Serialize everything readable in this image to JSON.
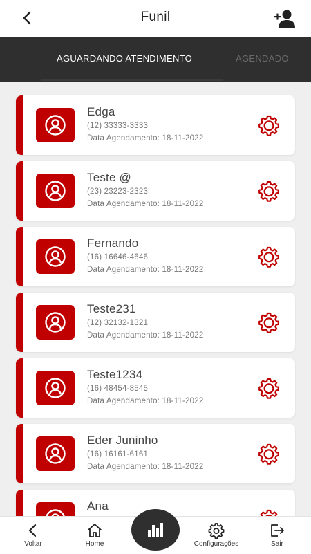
{
  "header": {
    "title": "Funil",
    "back_icon": "chevron-left-icon",
    "add_user_icon": "user-plus-icon"
  },
  "tabs": [
    {
      "label": "AGUARDANDO ATENDIMENTO",
      "active": true
    },
    {
      "label": "AGENDADO",
      "active": false
    }
  ],
  "contacts": [
    {
      "name": "Edga",
      "phone": "(12) 33333-3333",
      "date": "Data Agendamento: 18-11-2022"
    },
    {
      "name": "Teste @",
      "phone": "(23) 23223-2323",
      "date": "Data Agendamento: 18-11-2022"
    },
    {
      "name": "Fernando",
      "phone": "(16) 16646-4646",
      "date": "Data Agendamento: 18-11-2022"
    },
    {
      "name": "Teste231",
      "phone": "(12) 32132-1321",
      "date": "Data Agendamento: 18-11-2022"
    },
    {
      "name": "Teste1234",
      "phone": "(16) 48454-8545",
      "date": "Data Agendamento: 18-11-2022"
    },
    {
      "name": "Eder Juninho",
      "phone": "(16) 16161-6161",
      "date": "Data Agendamento: 18-11-2022"
    },
    {
      "name": "Ana",
      "phone": "",
      "date": ""
    }
  ],
  "bottom_nav": {
    "voltar": "Voltar",
    "home": "Home",
    "configuracoes": "Configurações",
    "sair": "Sair"
  },
  "colors": {
    "accent": "#c00000",
    "dark": "#2f2f2f"
  }
}
